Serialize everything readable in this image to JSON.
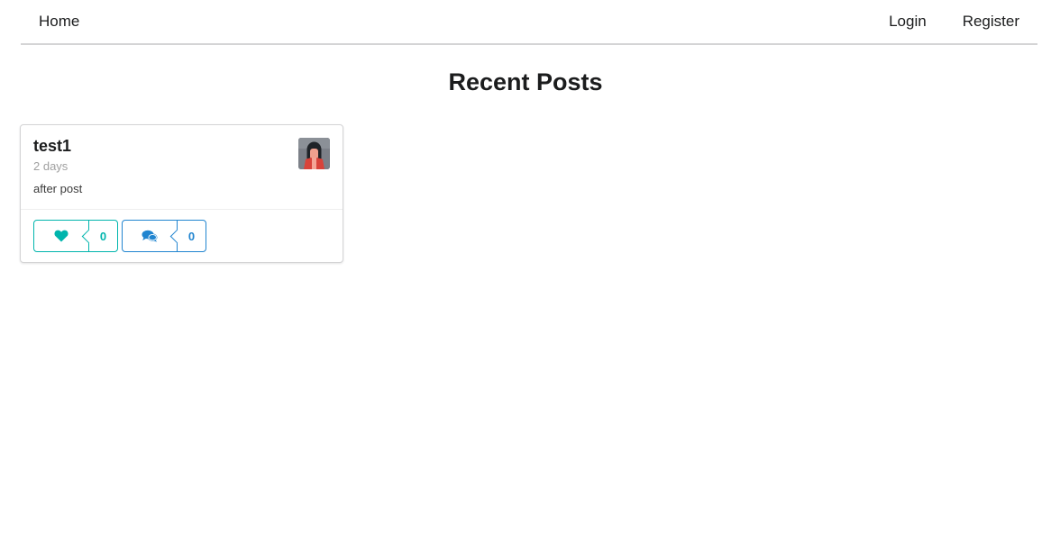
{
  "nav": {
    "home_label": "Home",
    "login_label": "Login",
    "register_label": "Register"
  },
  "page": {
    "title": "Recent Posts"
  },
  "posts": [
    {
      "username": "test1",
      "time_ago": "2 days",
      "body": "after post",
      "like_count": "0",
      "comment_count": "0",
      "like_icon": "heart-icon",
      "comment_icon": "comments-icon"
    }
  ],
  "colors": {
    "like_accent": "#00b5ad",
    "comment_accent": "#2185d0",
    "divider": "#d4d4d5"
  }
}
